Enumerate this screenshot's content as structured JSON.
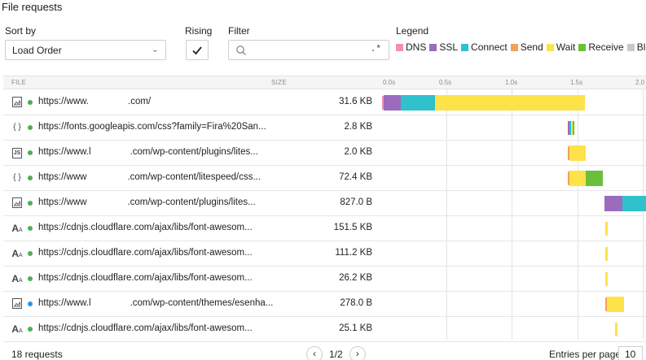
{
  "title": "File requests",
  "controls": {
    "sort_label": "Sort by",
    "sort_value": "Load Order",
    "rising_label": "Rising",
    "filter_label": "Filter",
    "filter_placeholder": "",
    "filter_regex": ".*",
    "legend_label": "Legend"
  },
  "legend": [
    {
      "label": "DNS",
      "color": "#f48fb1"
    },
    {
      "label": "SSL",
      "color": "#9b6bbd"
    },
    {
      "label": "Connect",
      "color": "#2fc1cc"
    },
    {
      "label": "Send",
      "color": "#f4a05a"
    },
    {
      "label": "Wait",
      "color": "#fde24a"
    },
    {
      "label": "Receive",
      "color": "#6cbf3a"
    },
    {
      "label": "Blocke",
      "color": "#c8c8c8"
    }
  ],
  "table": {
    "col_file": "FILE",
    "col_size": "SIZE",
    "ticks": [
      "0.0s",
      "0.5s",
      "1.0s",
      "1.5s",
      "2.0"
    ],
    "rows": [
      {
        "type_icon": "image-file-icon",
        "dot": "#4caf50",
        "url_start": "https://www.",
        "url_end": ".com/",
        "size": "31.6 KB"
      },
      {
        "type_icon": "css-file-icon",
        "dot": "#4caf50",
        "url_start": "https://fonts.googleapis.com/css?family=Fira%20San...",
        "url_end": "",
        "size": "2.8 KB"
      },
      {
        "type_icon": "js-file-icon",
        "dot": "#4caf50",
        "url_start": "https://www.l",
        "url_end": ".com/wp-content/plugins/lites...",
        "size": "2.0 KB"
      },
      {
        "type_icon": "css-file-icon",
        "dot": "#4caf50",
        "url_start": "https://www",
        "url_end": ".com/wp-content/litespeed/css...",
        "size": "72.4 KB"
      },
      {
        "type_icon": "image-file-icon",
        "dot": "#4caf50",
        "url_start": "https://www",
        "url_end": ".com/wp-content/plugins/lites...",
        "size": "827.0 B"
      },
      {
        "type_icon": "font-file-icon",
        "dot": "#4caf50",
        "url_start": "https://cdnjs.cloudflare.com/ajax/libs/font-awesom...",
        "url_end": "",
        "size": "151.5 KB"
      },
      {
        "type_icon": "font-file-icon",
        "dot": "#4caf50",
        "url_start": "https://cdnjs.cloudflare.com/ajax/libs/font-awesom...",
        "url_end": "",
        "size": "111.2 KB"
      },
      {
        "type_icon": "font-file-icon",
        "dot": "#4caf50",
        "url_start": "https://cdnjs.cloudflare.com/ajax/libs/font-awesom...",
        "url_end": "",
        "size": "26.2 KB"
      },
      {
        "type_icon": "image-file-icon",
        "dot": "#2196f3",
        "url_start": "https://www.l",
        "url_end": ".com/wp-content/themes/esenha...",
        "size": "278.0 B"
      },
      {
        "type_icon": "font-file-icon",
        "dot": "#4caf50",
        "url_start": "https://cdnjs.cloudflare.com/ajax/libs/font-awesom...",
        "url_end": "",
        "size": "25.1 KB"
      }
    ]
  },
  "footer": {
    "requests": "18 requests",
    "page": "1/2",
    "entries_label": "Entries per page:",
    "entries_value": "10"
  }
}
